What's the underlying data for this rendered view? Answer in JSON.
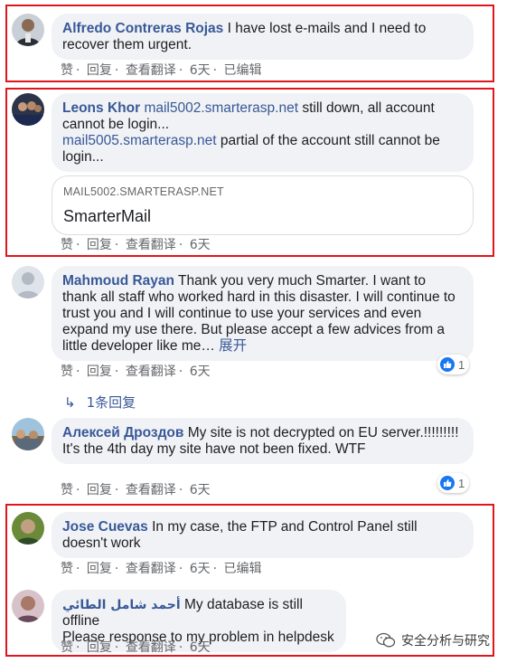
{
  "comments": [
    {
      "author": "Alfredo Contreras Rojas",
      "text": "I have lost e-mails and I need to recover them urgent.",
      "actions": {
        "like": "赞",
        "reply": "回复",
        "translate": "查看翻译",
        "time": "6天",
        "edited": "已编辑"
      },
      "highlighted": true
    },
    {
      "author": "Leons Khor",
      "link1": "mail5002.smarterasp.net",
      "text1": "still down, all account cannot be login...",
      "link2": "mail5005.smarterasp.net",
      "text2": "partial of the account still cannot be login...",
      "preview": {
        "domain": "MAIL5002.SMARTERASP.NET",
        "title": "SmarterMail"
      },
      "actions": {
        "like": "赞",
        "reply": "回复",
        "translate": "查看翻译",
        "time": "6天"
      },
      "highlighted": true
    },
    {
      "author": "Mahmoud Rayan",
      "text": "Thank you very much Smarter. I want to thank all staff who worked hard in this disaster. I will continue to trust you and I will continue to use your services and even expand my use there. But please accept a few advices from a little developer like me…",
      "more": "展开",
      "reactions": "1",
      "actions": {
        "like": "赞",
        "reply": "回复",
        "translate": "查看翻译",
        "time": "6天"
      },
      "replies_label": "1条回复",
      "highlighted": false
    },
    {
      "author": "Алексей Дроздов",
      "text1": "My site is not decrypted on EU server.!!!!!!!!!",
      "text2": "It's the 4th day my site have not been fixed. WTF",
      "reactions": "1",
      "actions": {
        "like": "赞",
        "reply": "回复",
        "translate": "查看翻译",
        "time": "6天"
      },
      "highlighted": false
    },
    {
      "author": "Jose Cuevas",
      "text": "In my case, the FTP and Control Panel still doesn't work",
      "actions": {
        "like": "赞",
        "reply": "回复",
        "translate": "查看翻译",
        "time": "6天",
        "edited": "已编辑"
      },
      "highlighted": true
    },
    {
      "author": "أحمد شامل الطائي",
      "text1": "My database is still offline",
      "text2": "Please response to my problem in helpdesk",
      "actions": {
        "like": "赞",
        "reply": "回复",
        "translate": "查看翻译",
        "time": "6天"
      },
      "highlighted": true
    }
  ],
  "watermark": "安全分析与研究",
  "colors": {
    "link": "#385898",
    "bubble": "#f0f2f5",
    "highlight": "#e0161c",
    "like": "#1877f2"
  }
}
